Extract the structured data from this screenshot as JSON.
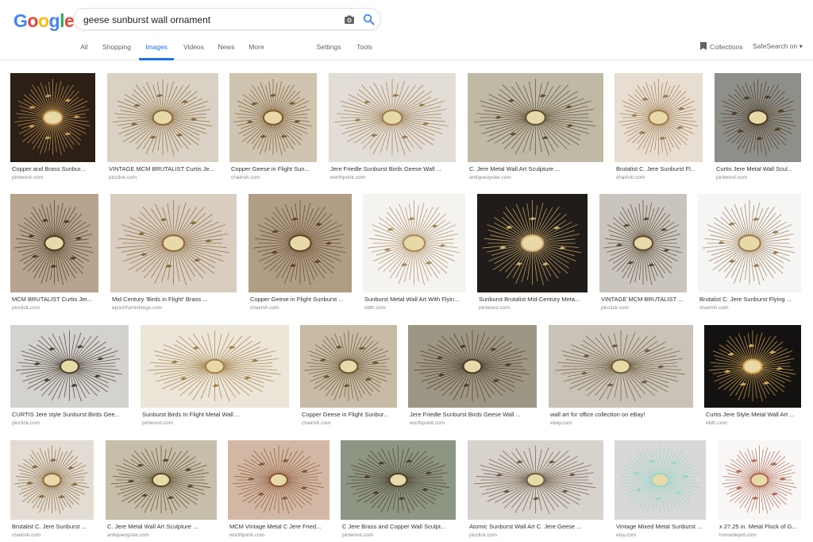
{
  "search": {
    "query": "geese sunburst wall ornament"
  },
  "tabs": [
    {
      "label": "All"
    },
    {
      "label": "Shopping"
    },
    {
      "label": "Images"
    },
    {
      "label": "Videos"
    },
    {
      "label": "News"
    },
    {
      "label": "More"
    },
    {
      "label": "Settings"
    },
    {
      "label": "Tools"
    }
  ],
  "header_right": {
    "collections": "Collections",
    "safesearch": "SafeSearch on"
  },
  "colors": {
    "accent": "#1a73e8"
  },
  "results": [
    {
      "title": "Copper and Brass Sunbur...",
      "source": "pinterest.com",
      "bg": "#2b1f16",
      "fg": "#c79a55"
    },
    {
      "title": "VINTAGE MCM BRUTALIST Curtis Je...",
      "source": "picclick.com",
      "bg": "#d9d2c4",
      "fg": "#8a6a3a"
    },
    {
      "title": "Copper Geese in Flight Sun...",
      "source": "chairish.com",
      "bg": "#cfc4b0",
      "fg": "#7a5a30"
    },
    {
      "title": "Jere Friedle Sunburst Birds Geese Wall ...",
      "source": "worthpoint.com",
      "bg": "#e2ddd6",
      "fg": "#9b7b4c"
    },
    {
      "title": "C. Jere Metal Wall Art Sculpture ...",
      "source": "antiqueoyster.com",
      "bg": "#bfb9a6",
      "fg": "#5e4e30"
    },
    {
      "title": "Brutalist C. Jere Sunburst Fl...",
      "source": "chairish.com",
      "bg": "#e7ddd0",
      "fg": "#9c7a4a"
    },
    {
      "title": "Curtis Jere Metal Wall Scul...",
      "source": "pinterest.com",
      "bg": "#8f8f8a",
      "fg": "#4c3c22"
    },
    {
      "title": "MCM BRUTALIST Curtis Jer...",
      "source": "picclick.com",
      "bg": "#b6a48f",
      "fg": "#4e3c22"
    },
    {
      "title": "Mid Century 'Birds in Flight' Brass ...",
      "source": "epochfurnishings.com",
      "bg": "#d8cdbf",
      "fg": "#8b6a3c"
    },
    {
      "title": "Copper Geese in Flight Sunburst ...",
      "source": "chairish.com",
      "bg": "#b19d84",
      "fg": "#5a4428"
    },
    {
      "title": "Sunburst Metal Wall Art With Flyin...",
      "source": "ebth.com",
      "bg": "#f4f3f0",
      "fg": "#a8875a"
    },
    {
      "title": "Sunburst Brutalist Mid-Century Meta...",
      "source": "pinterest.com",
      "bg": "#1f1c19",
      "fg": "#d4b070"
    },
    {
      "title": "VINTAGE MCM BRUTALIST ...",
      "source": "picclick.com",
      "bg": "#c9c5be",
      "fg": "#5b4a30"
    },
    {
      "title": "Brutalist C. Jere Sunburst Flying ...",
      "source": "chairish.com",
      "bg": "#f5f5f4",
      "fg": "#9a7a50"
    },
    {
      "title": "CURTIS Jere style Sunburst Birds Gee...",
      "source": "picclick.com",
      "bg": "#d3d2cf",
      "fg": "#4d4030"
    },
    {
      "title": "Sunburst Birds In Flight Metal Wall ...",
      "source": "pinterest.com",
      "bg": "#ece6d9",
      "fg": "#a07e45"
    },
    {
      "title": "Copper Geese in Flight Sunbur...",
      "source": "chairish.com",
      "bg": "#c7bba5",
      "fg": "#6d5534"
    },
    {
      "title": "Jere Friedle Sunburst Birds Geese Wall ...",
      "source": "worthpoint.com",
      "bg": "#9e9684",
      "fg": "#4a3c26"
    },
    {
      "title": "wall art for office collection on eBay!",
      "source": "ebay.com",
      "bg": "#c9c2b6",
      "fg": "#6e5a3c"
    },
    {
      "title": "Curtis Jere Style Metal Wall Art ...",
      "source": "ebth.com",
      "bg": "#141210",
      "fg": "#d6a858"
    },
    {
      "title": "Brutalist C. Jere Sunburst ...",
      "source": "chairish.com",
      "bg": "#e2dcd2",
      "fg": "#8b6c40"
    },
    {
      "title": "C. Jere Metal Wall Art Sculpture ...",
      "source": "antiqueoyster.com",
      "bg": "#c6bea9",
      "fg": "#5c4a2c"
    },
    {
      "title": "MCM Vintage Metal C Jere Fried...",
      "source": "worthpoint.com",
      "bg": "#d2b8a4",
      "fg": "#8a5636"
    },
    {
      "title": "C Jere Brass and Copper Wall Sculpt...",
      "source": "pinterest.com",
      "bg": "#8d9583",
      "fg": "#4b3e26"
    },
    {
      "title": "Atomic Sunburst Wall Art C. Jere Geese ...",
      "source": "picclick.com",
      "bg": "#d8d2cc",
      "fg": "#6b5a44"
    },
    {
      "title": "Vintage Mixed Metal Sunburst ...",
      "source": "etsy.com",
      "bg": "#d8d8d6",
      "fg": "#9ad6c9"
    },
    {
      "title": "x 27.25 in. Metal Flock of G...",
      "source": "homedepot.com",
      "bg": "#f8f7f6",
      "fg": "#b06a52"
    }
  ]
}
